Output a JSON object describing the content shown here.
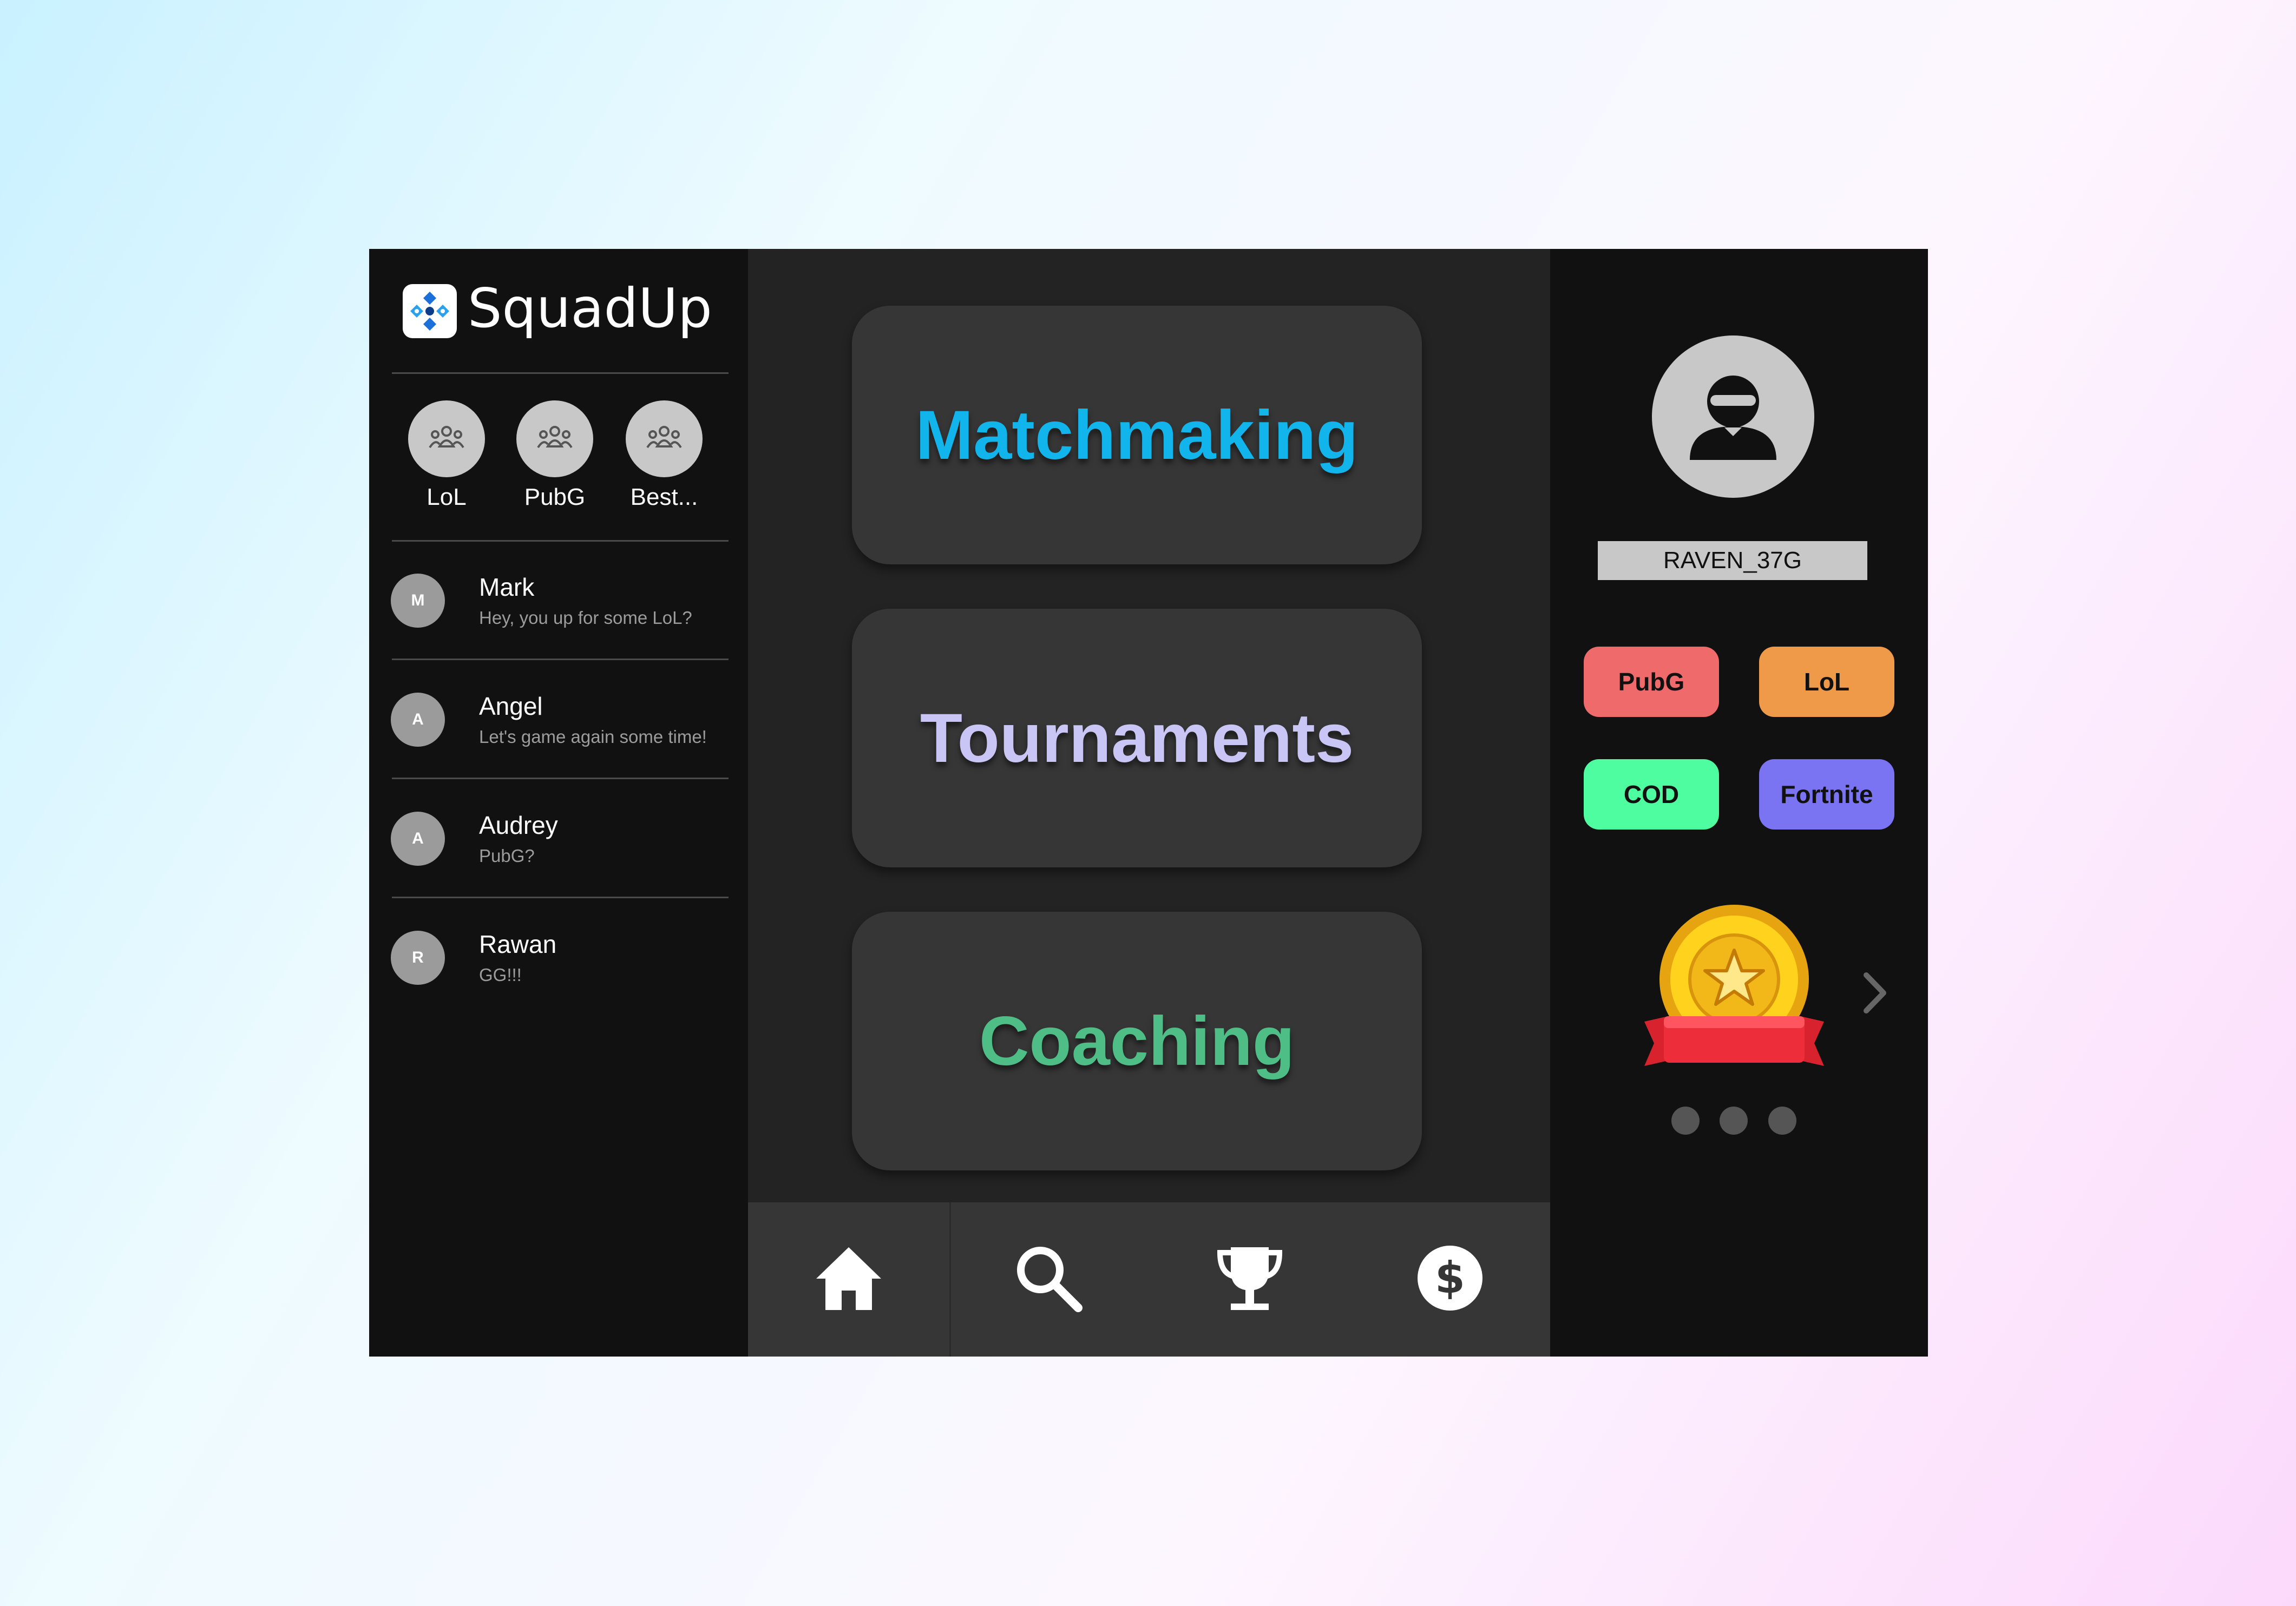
{
  "app": {
    "title": "SquadUp"
  },
  "groups": [
    {
      "label": "LoL"
    },
    {
      "label": "PubG"
    },
    {
      "label": "Best..."
    }
  ],
  "chats": [
    {
      "initial": "M",
      "name": "Mark",
      "message": "Hey, you up for some LoL?"
    },
    {
      "initial": "A",
      "name": "Angel",
      "message": "Let's game again some time!"
    },
    {
      "initial": "A",
      "name": "Audrey",
      "message": "PubG?"
    },
    {
      "initial": "R",
      "name": "Rawan",
      "message": "GG!!!"
    }
  ],
  "main_buttons": [
    {
      "label": "Matchmaking",
      "color": "#12b4ec"
    },
    {
      "label": "Tournaments",
      "color": "#c9c6f6"
    },
    {
      "label": "Coaching",
      "color": "#4fbd86"
    }
  ],
  "bottom_nav": [
    {
      "icon": "home-icon"
    },
    {
      "icon": "search-icon"
    },
    {
      "icon": "trophy-icon"
    },
    {
      "icon": "dollar-icon"
    }
  ],
  "profile": {
    "username": "RAVEN_37G",
    "tags": [
      {
        "label": "PubG",
        "color": "#ef6b6b"
      },
      {
        "label": "LoL",
        "color": "#ef9a48"
      },
      {
        "label": "COD",
        "color": "#4dfda0"
      },
      {
        "label": "Fortnite",
        "color": "#7a74f2"
      }
    ],
    "carousel_pages": 3
  }
}
